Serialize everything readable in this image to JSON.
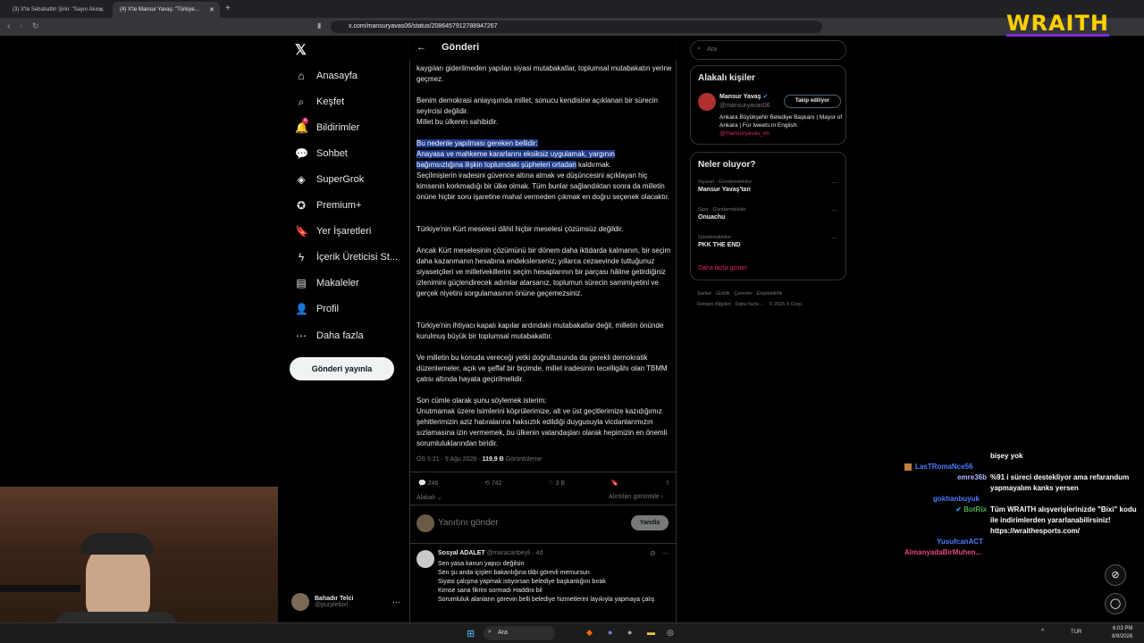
{
  "browser": {
    "tabs": [
      {
        "label": "(3) X'te Sebahattin Şirin: \"Sayın Akın...",
        "active": false
      },
      {
        "label": "(4) X'te Mansur Yavaş: \"Türkiye...",
        "active": true
      }
    ],
    "url": "x.com/mansuryavas06/status/2086457912788947267"
  },
  "overlay": {
    "brand": "WRAITH"
  },
  "sidebar": {
    "items": [
      {
        "label": "Anasayfa",
        "icon": "home-icon",
        "glyph": "⌂"
      },
      {
        "label": "Keşfet",
        "icon": "search-icon",
        "glyph": "⌕"
      },
      {
        "label": "Bildirimler",
        "icon": "bell-icon",
        "glyph": "🔔",
        "badge": "4"
      },
      {
        "label": "Sohbet",
        "icon": "chat-icon",
        "glyph": "💬"
      },
      {
        "label": "SuperGrok",
        "icon": "grok-icon",
        "glyph": "◈"
      },
      {
        "label": "Premium+",
        "icon": "premium-icon",
        "glyph": "✪"
      },
      {
        "label": "Yer İşaretleri",
        "icon": "bookmark-icon",
        "glyph": "🔖"
      },
      {
        "label": "İçerik Üreticisi St...",
        "icon": "lightning-icon",
        "glyph": "ϟ"
      },
      {
        "label": "Makaleler",
        "icon": "article-icon",
        "glyph": "▤"
      },
      {
        "label": "Profil",
        "icon": "profile-icon",
        "glyph": "👤"
      },
      {
        "label": "Daha fazla",
        "icon": "more-icon",
        "glyph": "⋯"
      }
    ],
    "post_button": "Gönderi yayınla",
    "account": {
      "name": "Bahadır Telci",
      "handle": "@purplebixl"
    }
  },
  "main": {
    "header_title": "Gönderi",
    "paragraphs": [
      "kaygıları giderilmeden yapılan siyasi mutabakatlar, toplumsal mutabakatın yerine geçmez.",
      "Benim demokrasi anlayışımda millet, sonucu kendisine açıklanan bir sürecin seyircisi değildir.\nMillet bu ülkenin sahibidir.",
      "Seçilmişlerin iradesini güvence altına almak ve düşüncesini açıklayan hiç kimsenin korkmadığı bir ülke olmak. Tüm bunlar sağlandıktan sonra da milletin önüne hiçbir soru işaretine mahal vermeden çıkmak en doğru seçenek olacaktır.",
      "Türkiye'nin Kürt meselesi dâhil hiçbir meselesi çözümsüz değildir.",
      "Ancak Kürt meselesinin çözümünü bir dönem daha iktidarda kalmanın, bir seçim daha kazanmanın hesabına endekslerseniz; yıllarca cezaevinde tuttuğunuz siyasetçileri ve milletvekillerini seçim hesaplarının bir parçası hâline getirdiğiniz izlenimini güçlendirecek adımlar atarsanız, toplumun sürecin samimiyetini ve gerçek niyetini sorgulamasının önüne geçemezsiniz.",
      "Türkiye'nin ihtiyacı kapalı kapılar ardındaki mutabakatlar değil, milletin önünde kurulmuş büyük bir toplumsal mutabakattır.",
      "Ve milletin bu konuda vereceği yetki doğrultusunda da gerekli demokratik düzenlemeler, açık ve şeffaf bir biçimde, millet iradesinin tecelligâhı olan TBMM çatısı altında hayata geçirilmelidir.",
      "Son cümle olarak şunu söylemek isterim:\nUnutmamak üzere isimlerini köprülerimize, alt ve üst geçitlerimize kazıdığımız şehitlerimizin aziz hatıralarına haksızlık edildiği duygusuyla vicdanlarımızın sızlamasına izin vermemek, bu ülkenin vatandaşları olarak hepimizin en önemli sorumluluklarından biridir."
    ],
    "highlight_lines": [
      "Bu nedenle yapılması gereken bellidir:",
      "Anayasa ve mahkeme kararlarını eksiksiz uygulamak, yargının",
      "bağımsızlığına ilişkin toplumdaki şüpheleri ortadan"
    ],
    "highlight_tail": " kaldırmak.",
    "timestamp": "ÖS 5:21 · 9 Ağu 2026 · ",
    "views_count": "119,9 B",
    "views_label": " Görüntüleme",
    "actions": {
      "replies": "246",
      "reposts": "742",
      "likes": "3 B"
    },
    "relevant_label": "Alakalı",
    "quotes_label": "Alıntıları görüntüle",
    "reply_placeholder": "Yanıtını gönder",
    "reply_button": "Yanıtla",
    "reply": {
      "name": "Sosyal ADALET",
      "handle": "@maracanbeyli · 4d",
      "lines": [
        "Sen yasa kanun yapıcı değilsin",
        "Sen şu anda içişleri bakanlığına tâbi görevli memursun",
        "Siyasi çalışma yapmak istiyorsan belediye başkanlığını bırak",
        "Kimse sana fikrini sormadı Haddini bil",
        "Sorumluluk alanların görevin belli belediye hizmetlerini layıkıyla yapmaya çalış"
      ]
    }
  },
  "right": {
    "search_placeholder": "Ara",
    "related_title": "Alakalı kişiler",
    "person": {
      "name": "Mansur Yavaş",
      "handle": "@mansuryavas06",
      "follow_button": "Takip ediliyor",
      "bio": "Ankara Büyükşehir Belediye Başkanı | Mayor of Ankara | For tweets in English:",
      "bio_link": "@mansuryavas_en"
    },
    "trends_title": "Neler oluyor?",
    "trends": [
      {
        "context": "Siyaset · Gündemdekiler",
        "name": "Mansur Yavaş'tan"
      },
      {
        "context": "Spor · Gündemdekiler",
        "name": "Onuachu"
      },
      {
        "context": "Gündemdekiler",
        "name": "PKK THE END"
      }
    ],
    "show_more": "Daha fazla göster",
    "footer": [
      "Şartlar",
      "Gizlilik",
      "Çerezler",
      "Erişilebilirlik",
      "Reklam Bilgileri",
      "Daha fazla ···",
      "© 2026 X Corp."
    ]
  },
  "chat": [
    {
      "user": "",
      "msg": "bişey yok",
      "color": "#ffffff"
    },
    {
      "user": "LasTRomaNce56",
      "msg": "",
      "color": "#4a7cff"
    },
    {
      "user": "emre36b",
      "msg": "%91 i süreci destekliyor ama refarandum yapmayalım kanks yersen",
      "color": "#aab8ff"
    },
    {
      "user": "gokhanbuyuk",
      "msg": "",
      "color": "#4a7cff"
    },
    {
      "user": "BotRix",
      "msg": "Tüm WRAITH alışverişlerinizde \"Bixi\" kodu ile indirimlerden yararlanabilirsiniz! https://wraithesports.com/",
      "color": "#4caf50"
    },
    {
      "user": "YusufcanACT",
      "msg": "",
      "color": "#4a7cff"
    },
    {
      "user": "AlmanyadaBirMuhen...",
      "msg": "",
      "color": "#e0457b"
    }
  ],
  "taskbar": {
    "search": "Ara",
    "lang": "TUR",
    "time": "6:03 PM",
    "date": "8/9/2026"
  },
  "streamer_cam": "webcam-feed"
}
